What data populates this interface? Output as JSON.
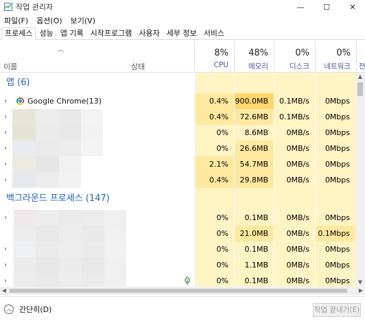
{
  "window": {
    "title": "작업 관리자",
    "minimize": "—",
    "maximize": "☐",
    "close": "✕"
  },
  "menu": [
    "파일(F)",
    "옵션(O)",
    "보기(V)"
  ],
  "tabs": [
    "프로세스",
    "성능",
    "앱 기록",
    "시작프로그램",
    "사용자",
    "세부 정보",
    "서비스"
  ],
  "header": {
    "name": "이름",
    "status": "상태",
    "columns": [
      {
        "pct": "8%",
        "label": "CPU"
      },
      {
        "pct": "48%",
        "label": "메모리"
      },
      {
        "pct": "0%",
        "label": "디스크"
      },
      {
        "pct": "0%",
        "label": "네트워크"
      },
      {
        "pct": "",
        "label": "전"
      }
    ]
  },
  "groups": {
    "apps": "앱 (6)",
    "background": "백그라운드 프로세스 (147)"
  },
  "app_rows": [
    {
      "name": "Google Chrome(13)",
      "cpu": "0.4%",
      "mem": "900.0MB",
      "disk": "0.1MB/s",
      "net": "0Mbps"
    },
    {
      "name": "",
      "cpu": "0.4%",
      "mem": "72.6MB",
      "disk": "0.1MB/s",
      "net": "0Mbps"
    },
    {
      "name": "",
      "cpu": "0%",
      "mem": "8.6MB",
      "disk": "0MB/s",
      "net": "0Mbps"
    },
    {
      "name": "",
      "cpu": "0%",
      "mem": "26.6MB",
      "disk": "0MB/s",
      "net": "0Mbps"
    },
    {
      "name": "",
      "cpu": "2.1%",
      "mem": "54.7MB",
      "disk": "0MB/s",
      "net": "0Mbps"
    },
    {
      "name": "",
      "cpu": "0.4%",
      "mem": "29.8MB",
      "disk": "0MB/s",
      "net": "0Mbps"
    }
  ],
  "bg_rows": [
    {
      "cpu": "0%",
      "mem": "0.1MB",
      "disk": "0MB/s",
      "net": "0Mbps"
    },
    {
      "cpu": "0%",
      "mem": "21.0MB",
      "disk": "0MB/s",
      "net": "0.1Mbps"
    },
    {
      "cpu": "0%",
      "mem": "0.1MB",
      "disk": "0MB/s",
      "net": "0Mbps"
    },
    {
      "cpu": "0%",
      "mem": "1.1MB",
      "disk": "0MB/s",
      "net": "0Mbps"
    },
    {
      "cpu": "0%",
      "mem": "0.1MB",
      "disk": "0MB/s",
      "net": "0Mbps"
    }
  ],
  "footer": {
    "fewer": "간단히(D)",
    "end_task": "작업 끝내기(E)"
  },
  "colors": {
    "cpu_light": "#fff4c4",
    "cpu_med": "#ffe9a0",
    "mem_hot": "#ffd66e",
    "accent": "#1f5fbf"
  },
  "icons": {
    "app": "task-manager-icon",
    "chrome": "chrome-icon",
    "leaf": "leaf-icon"
  }
}
